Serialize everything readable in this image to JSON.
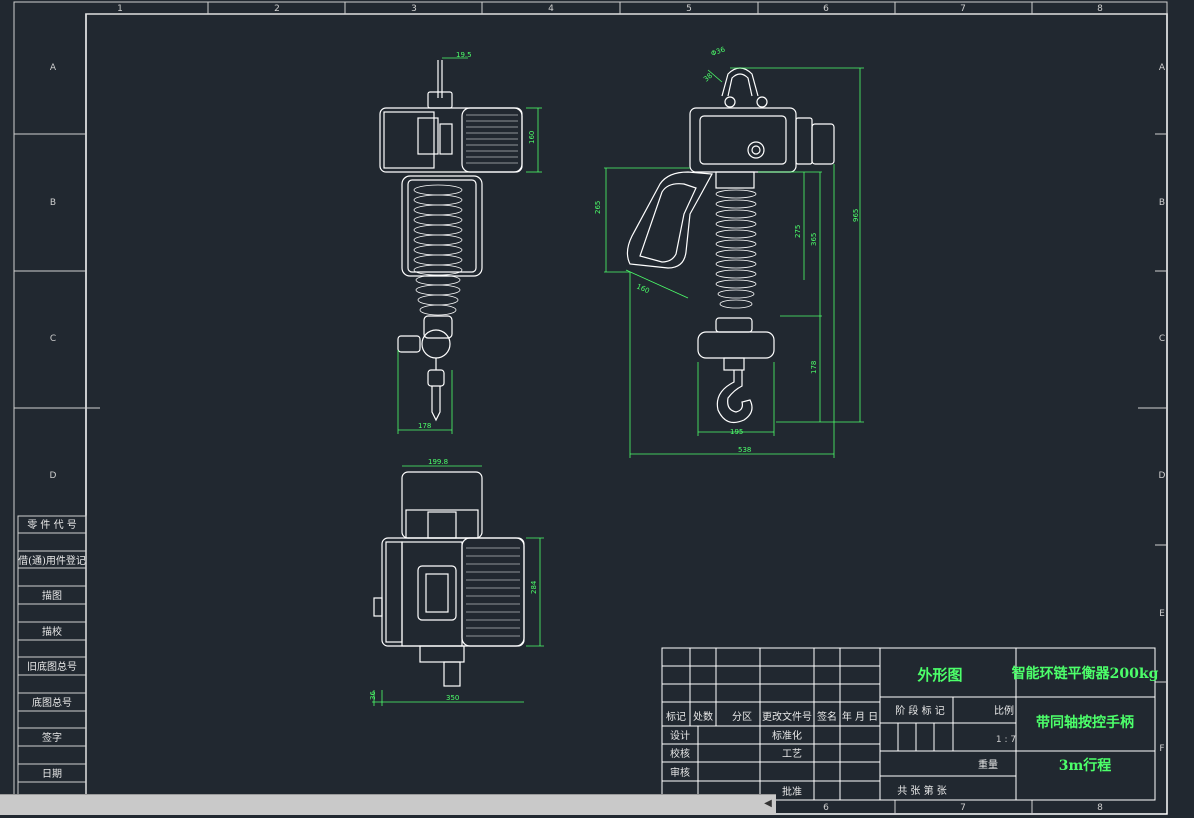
{
  "frame": {
    "columns": [
      "1",
      "2",
      "3",
      "4",
      "5",
      "6",
      "7",
      "8"
    ],
    "rows": [
      "A",
      "B",
      "C",
      "D",
      "E",
      "F"
    ]
  },
  "side_table": {
    "labels": [
      "零 件 代 号",
      "借(通)用件登记",
      "描图",
      "描校",
      "旧底图总号",
      "底图总号",
      "签字",
      "日期"
    ]
  },
  "dimensions": {
    "d1": "19.5",
    "d2": "160",
    "d3": "178",
    "d4": "199.8",
    "d5": "284",
    "d6": "350",
    "d7": "36",
    "d8": "Φ36",
    "d9": "38",
    "d10": "265",
    "d11": "275",
    "d12": "365",
    "d13": "965",
    "d14": "160",
    "d15": "178",
    "d16": "195",
    "d17": "538"
  },
  "title_block": {
    "drawing_type": "外形图",
    "product_name": "智能环链平衡器200kg",
    "product_sub": "带同轴按控手柄",
    "stroke": "3m行程",
    "headers": [
      "标记",
      "处数",
      "分区",
      "更改文件号",
      "签名",
      "年 月 日"
    ],
    "roles_left": [
      "设计",
      "校核",
      "审核"
    ],
    "roles_mid": [
      "标准化",
      "工艺",
      "批准"
    ],
    "stage": "阶 段 标 记",
    "ratio_label": "比例",
    "ratio_value": "1 : 7",
    "weight_label": "重量",
    "sheet_info": "共   张   第   张"
  },
  "colors": {
    "background": "#212830",
    "lines": "#ffffff",
    "dimension": "#4cff6a"
  }
}
